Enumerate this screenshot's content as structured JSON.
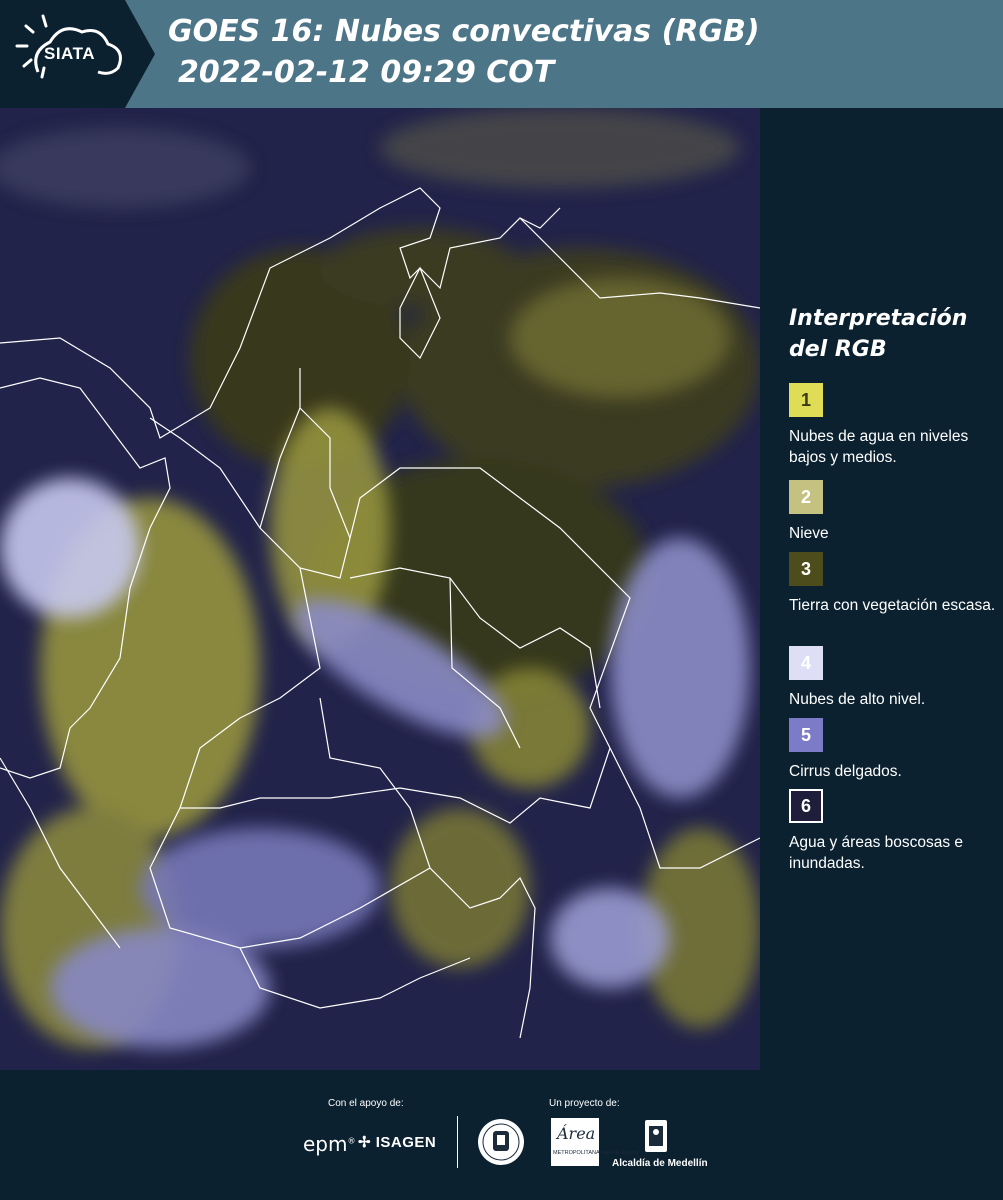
{
  "header": {
    "logo_text": "SIATA",
    "title_line1": "GOES 16: Nubes convectivas (RGB)",
    "title_line2": "2022-02-12 09:29 COT",
    "background_color": "#4d7588",
    "logo_block_color": "#0b2130"
  },
  "map": {
    "description_icon": "satellite-image",
    "border_color": "#ffffff"
  },
  "legend": {
    "title_line1": "Interpretación",
    "title_line2": "del RGB",
    "items": [
      {
        "number": "1",
        "label": "Nubes de agua en niveles bajos y medios.",
        "color": "#dfdd55",
        "text_color": "#3a3a14"
      },
      {
        "number": "2",
        "label": "Nieve",
        "color": "#c5c281",
        "text_color": "#ffffff"
      },
      {
        "number": "3",
        "label": "Tierra con vegetación escasa.",
        "color": "#4d4c1d",
        "text_color": "#ffffff"
      },
      {
        "number": "4",
        "label": "Nubes de alto nivel.",
        "color": "#dedff7",
        "text_color": "#ffffff"
      },
      {
        "number": "5",
        "label": "Cirrus delgados.",
        "color": "#7b7bc8",
        "text_color": "#ffffff"
      },
      {
        "number": "6",
        "label": "Agua y áreas boscosas e inundadas.",
        "color": "#1e1e3a",
        "text_color": "#ffffff"
      }
    ]
  },
  "footer": {
    "support_caption": "Con el apoyo de:",
    "project_caption": "Un proyecto de:",
    "epm_logo": "epm",
    "isagen_logo": "ISAGEN",
    "area_logo_word": "Área",
    "area_logo_sub": "METROPOLITANA Valle de Aburrá",
    "alcaldia_logo": "Alcaldía de Medellín"
  }
}
